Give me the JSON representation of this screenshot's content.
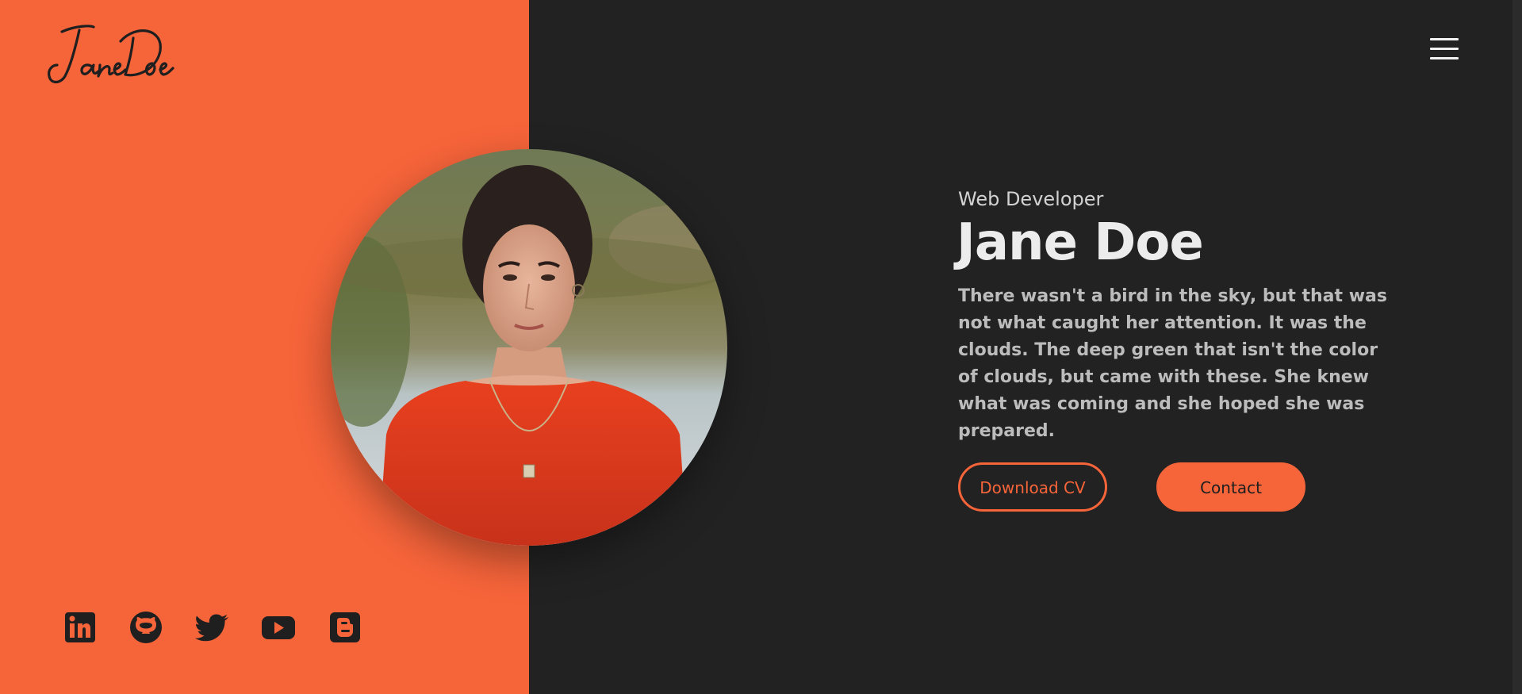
{
  "brand": {
    "logo_text": "Jane Doe",
    "logo_icon": "signature-logo"
  },
  "nav": {
    "menu_icon": "hamburger-menu-icon"
  },
  "hero": {
    "role": "Web Developer",
    "name": "Jane Doe",
    "bio": "There wasn't a bird in the sky, but that was not what caught her attention. It was the clouds. The deep green that isn't the color of clouds, but came with these. She knew what was coming and she hoped she was prepared.",
    "download_label": "Download CV",
    "contact_label": "Contact"
  },
  "social": [
    {
      "icon": "linkedin-icon"
    },
    {
      "icon": "github-icon"
    },
    {
      "icon": "twitter-icon"
    },
    {
      "icon": "youtube-icon"
    },
    {
      "icon": "blogger-icon"
    }
  ],
  "colors": {
    "accent": "#f6643a",
    "dark_background": "#222222",
    "heading_text": "#ececec",
    "body_text": "#bcbcbc"
  }
}
